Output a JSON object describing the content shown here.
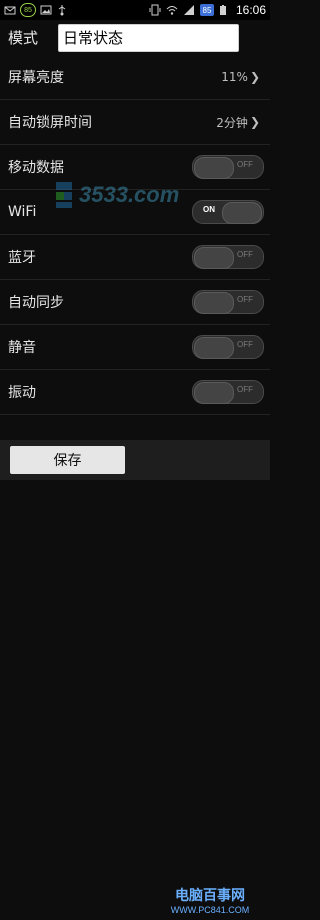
{
  "status_bar": {
    "time": "16:06",
    "badge_value": "85",
    "notif_count": "85",
    "icons": [
      "mail-icon",
      "badge-icon",
      "image-icon",
      "usb-icon",
      "vibrate-icon",
      "wifi-icon",
      "signal-icon",
      "battery-icon"
    ]
  },
  "mode": {
    "label": "模式",
    "value": "日常状态"
  },
  "settings": [
    {
      "label": "屏幕亮度",
      "value": "11%",
      "type": "value"
    },
    {
      "label": "自动锁屏时间",
      "value": "2分钟",
      "type": "value"
    },
    {
      "label": "移动数据",
      "toggle": "OFF",
      "type": "toggle"
    },
    {
      "label": "WiFi",
      "toggle": "ON",
      "type": "toggle"
    },
    {
      "label": "蓝牙",
      "toggle": "OFF",
      "type": "toggle"
    },
    {
      "label": "自动同步",
      "toggle": "OFF",
      "type": "toggle"
    },
    {
      "label": "静音",
      "toggle": "OFF",
      "type": "toggle"
    },
    {
      "label": "振动",
      "toggle": "OFF",
      "type": "toggle"
    }
  ],
  "bottom": {
    "save_label": "保存"
  },
  "watermark": {
    "center_text": "3533.com",
    "bottom_title": "电脑百事网",
    "bottom_url": "WWW.PC841.COM"
  },
  "colors": {
    "background": "#0d0d0d",
    "wifi_on_text": "#ffffff",
    "toggle_track": "#2c2c2c",
    "watermark_blue": "#6ab0ff"
  }
}
